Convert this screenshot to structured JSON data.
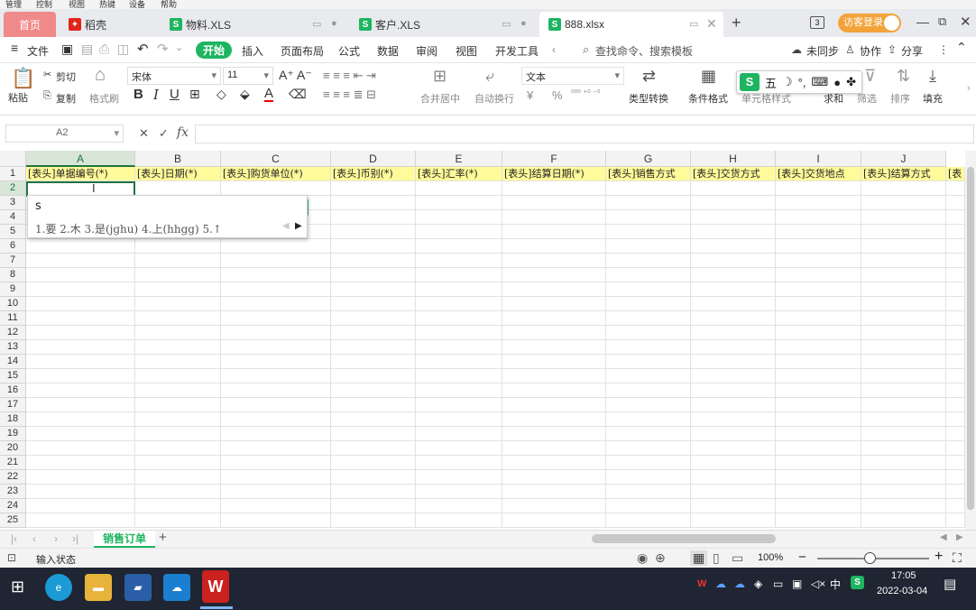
{
  "outer_menu": [
    "管理",
    "控制",
    "视图",
    "热键",
    "设备",
    "帮助"
  ],
  "tabs": {
    "home": "首页",
    "items": [
      {
        "label": "稻壳",
        "icon": "daoke-icon"
      },
      {
        "label": "物料.XLS",
        "icon": "sheet-icon"
      },
      {
        "label": "客户.XLS",
        "icon": "sheet-icon"
      },
      {
        "label": "888.xlsx",
        "icon": "sheet-icon"
      }
    ],
    "add": "+",
    "badge": "3",
    "login": "访客登录"
  },
  "menu": {
    "file": "文件",
    "items": [
      "开始",
      "插入",
      "页面布局",
      "公式",
      "数据",
      "审阅",
      "视图",
      "开发工具"
    ],
    "active": "开始",
    "search_placeholder": "查找命令、搜索模板",
    "sync": "未同步",
    "collab": "协作",
    "share": "分享"
  },
  "ribbon": {
    "paste": "粘贴",
    "cut": "剪切",
    "copy": "复制",
    "format_painter": "格式刷",
    "font": "宋体",
    "size": "11",
    "merge": "合并居中",
    "wrap": "自动换行",
    "numfmt": "文本",
    "convert": "类型转换",
    "cond": "条件格式",
    "cellstyle": "单元格样式",
    "sum": "求和",
    "filter": "筛选",
    "sort": "排序",
    "fill": "填充",
    "bold": "B",
    "italic": "I",
    "underline": "U",
    "fontcolor": "A",
    "currency": "¥",
    "percent": "%"
  },
  "formula_bar": {
    "name_box": "A2",
    "fx": "fx",
    "value": ""
  },
  "columns": [
    "A",
    "B",
    "C",
    "D",
    "E",
    "F",
    "G",
    "H",
    "I",
    "J"
  ],
  "header_row": [
    "[表头]单据编号(*)",
    "[表头]日期(*)",
    "[表头]购货单位(*)",
    "[表头]币别(*)",
    "[表头]汇率(*)",
    "[表头]结算日期(*)",
    "[表头]销售方式",
    "[表头]交货方式",
    "[表头]交货地点",
    "[表头]结算方式",
    "[表"
  ],
  "row_numbers": [
    "1",
    "2",
    "3",
    "4",
    "5",
    "6",
    "7",
    "8",
    "9",
    "10",
    "11",
    "12",
    "13",
    "14",
    "15",
    "16",
    "17",
    "18",
    "19",
    "20",
    "21",
    "22",
    "23",
    "24",
    "25"
  ],
  "ime": {
    "input": "s",
    "candidates": "1.要  2.木  3.是(jghu)  4.上(hhgg)  5.↑",
    "toolbar": [
      "五",
      "☽",
      "°,",
      "⌨",
      "●",
      "✤"
    ]
  },
  "sheet_tabs": {
    "active": "销售订单",
    "add": "+"
  },
  "status": {
    "mode": "输入状态",
    "zoom": "100%",
    "minus": "−",
    "plus": "+"
  },
  "taskbar": {
    "time": "17:05",
    "date": "2022-03-04",
    "ime_lang": "中"
  },
  "colors": {
    "accent": "#217346",
    "header_fill": "#fffb9a",
    "active_tab": "#1db561",
    "home_tab": "#f08a8a",
    "taskbar": "#1f2532"
  }
}
